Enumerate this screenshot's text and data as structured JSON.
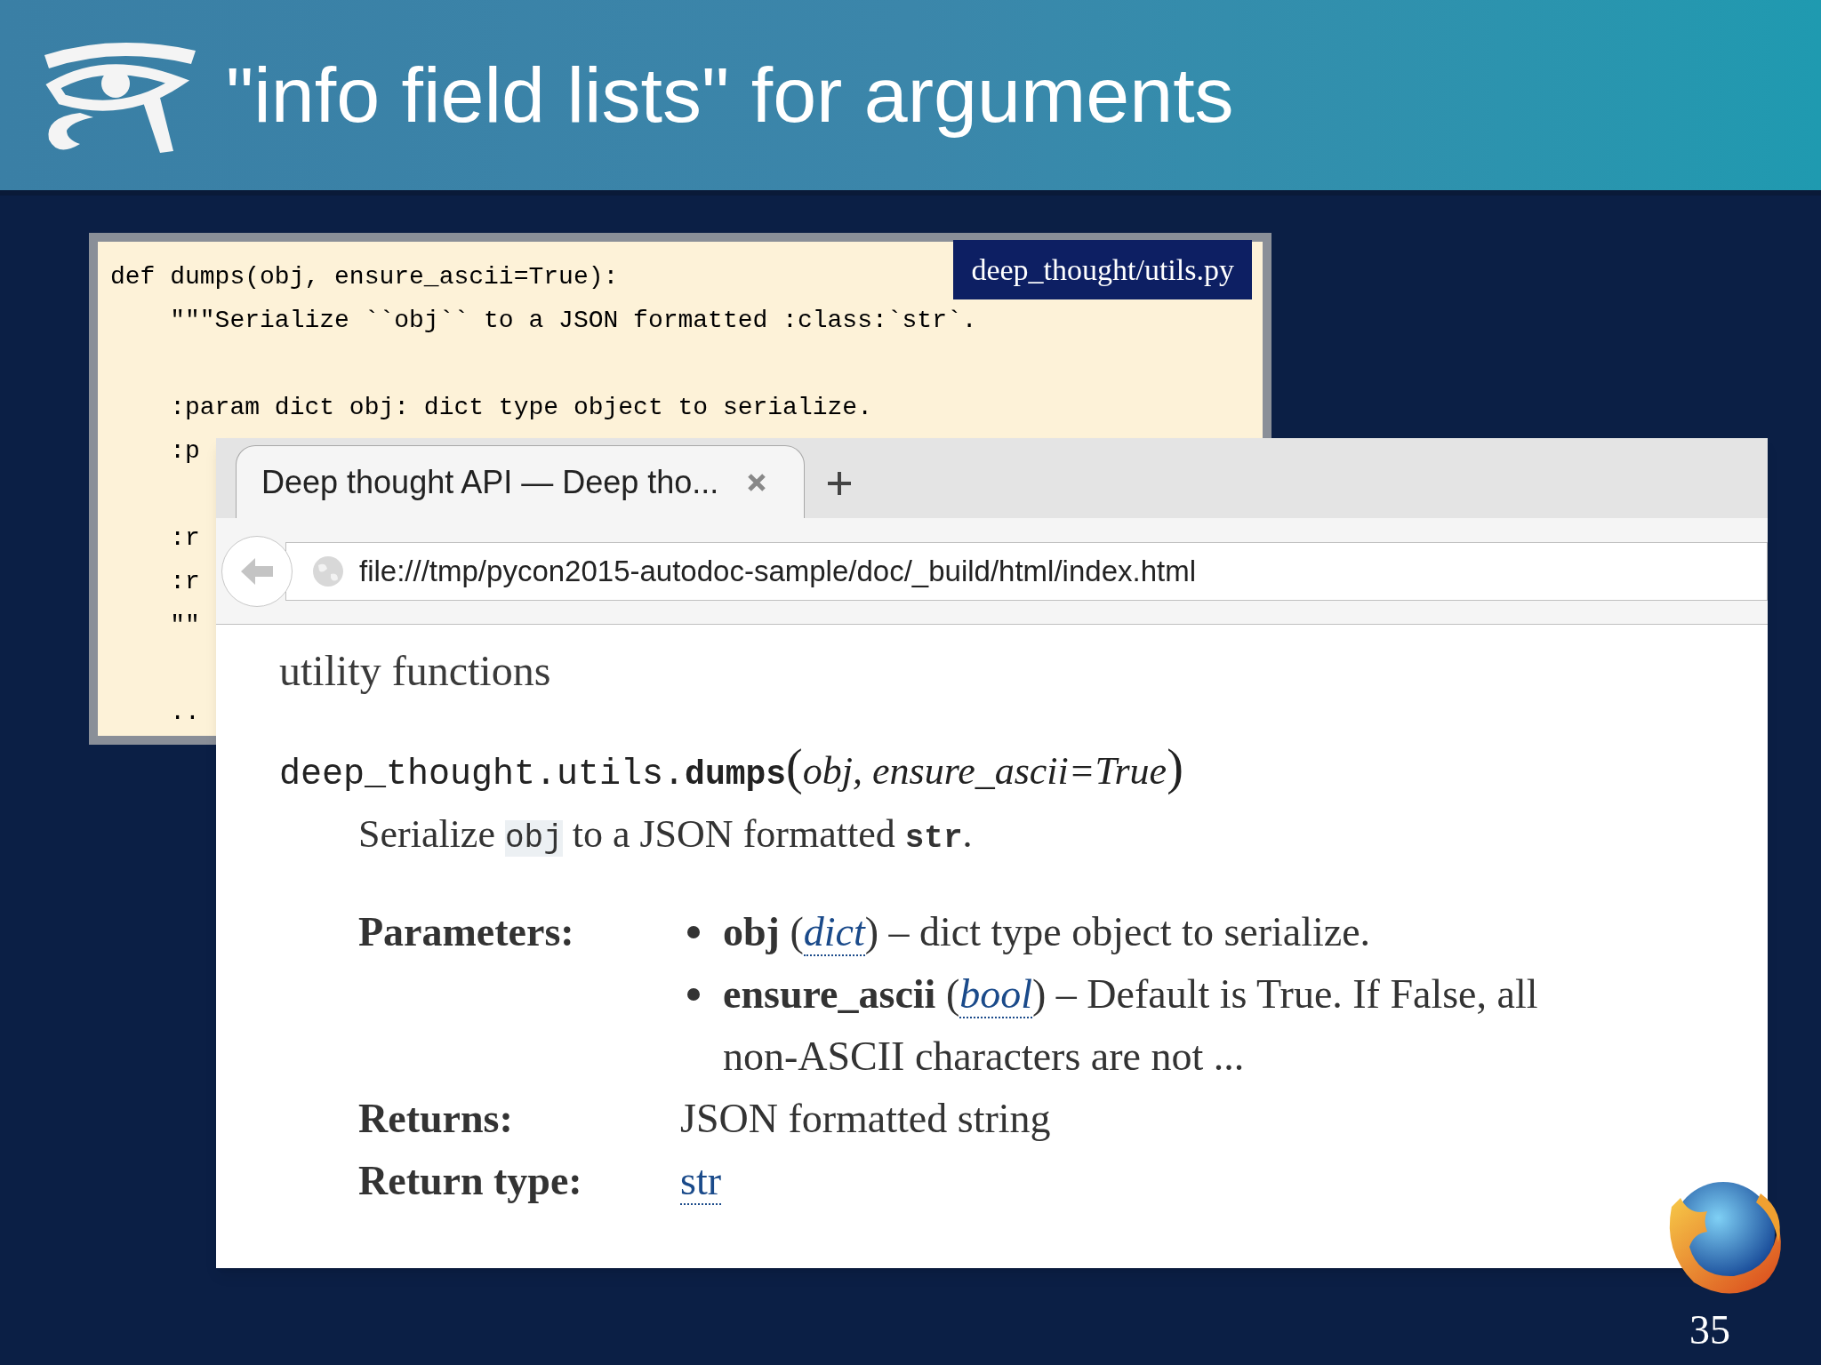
{
  "slide": {
    "title": "\"info field lists\" for arguments",
    "page_number": "35"
  },
  "code_panel": {
    "filename": "deep_thought/utils.py",
    "blocks": [
      [
        "def dumps(obj, ensure_ascii=True):",
        "    \"\"\"Serialize ``obj`` to a JSON formatted :class:`str`."
      ],
      [
        "    :param dict obj: dict type object to serialize.",
        "    :p"
      ],
      [
        "    :r",
        "    :r",
        "    \"\""
      ],
      [
        "    .."
      ]
    ]
  },
  "browser": {
    "tab_title": "Deep thought API — Deep tho...",
    "url": "file:///tmp/pycon2015-autodoc-sample/doc/_build/html/index.html"
  },
  "doc": {
    "heading": "utility functions",
    "signature": {
      "module": "deep_thought.utils.",
      "name": "dumps",
      "open": "(",
      "params": "obj, ensure_ascii=True",
      "close": ")"
    },
    "description": [
      {
        "kind": "text",
        "text": "Serialize "
      },
      {
        "kind": "code",
        "text": "obj"
      },
      {
        "kind": "text",
        "text": " to a JSON formatted "
      },
      {
        "kind": "strong_code",
        "text": "str"
      },
      {
        "kind": "text",
        "text": "."
      }
    ],
    "parameters_label": "Parameters:",
    "parameters": [
      {
        "name": "obj",
        "open": " (",
        "type": "dict",
        "rest": ") – dict type object to serialize."
      },
      {
        "name": "ensure_ascii",
        "open": " (",
        "type": "bool",
        "rest": ") – Default is True. If False, all non-ASCII characters are not ..."
      }
    ],
    "returns_label": "Returns:",
    "returns": "JSON formatted string",
    "return_type_label": "Return type:",
    "return_type": "str"
  }
}
